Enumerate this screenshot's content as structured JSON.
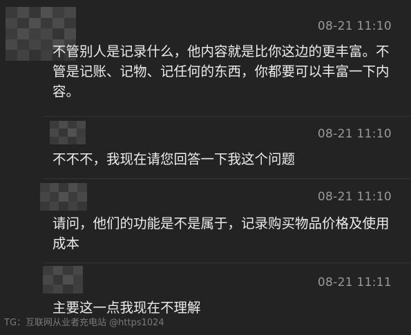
{
  "messages": [
    {
      "time": "08-21 11:10",
      "text": "不管别人是记录什么，他内容就是比你这边的更丰富。不管是记账、记物、记任何的东西，你都要可以丰富一下内容。"
    },
    {
      "time": "08-21 11:10",
      "text": "不不不，我现在请您回答一下我这个问题"
    },
    {
      "time": "08-21 11:10",
      "text": "请问，他们的功能是不是属于，记录购买物品价格及使用成本"
    },
    {
      "time": "08-21 11:11",
      "text": "主要这一点我现在不理解"
    }
  ],
  "watermark": "TG：互联网从业者充电站 @https1024"
}
